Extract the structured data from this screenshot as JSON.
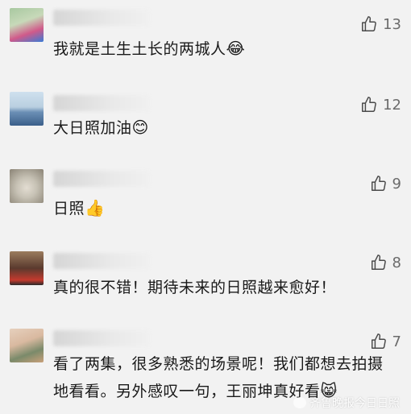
{
  "comments": [
    {
      "likes": "13",
      "text": "我就是土生土长的两城人",
      "emoji": "😂",
      "avatar_colors": [
        "#a8c8a0",
        "#d05a8a",
        "#3a7bd5"
      ]
    },
    {
      "likes": "12",
      "text": "大日照加油",
      "emoji": "😊",
      "avatar_colors": [
        "#b9cfe0",
        "#3b5f8a",
        "#e7eef5"
      ]
    },
    {
      "likes": "9",
      "text": "日照",
      "emoji": "👍",
      "avatar_colors": [
        "#c7c2b5",
        "#8a8375",
        "#e3ddd2"
      ]
    },
    {
      "likes": "8",
      "text": "真的很不错！期待未来的日照越来愈好！",
      "emoji": "",
      "avatar_colors": [
        "#5a3a2e",
        "#c43a2e",
        "#9b7c5e"
      ]
    },
    {
      "likes": "7",
      "text": "看了两集，很多熟悉的场景呢！我们都想去拍摄地看看。另外感叹一句，王丽坤真好看",
      "emoji": "😸",
      "avatar_colors": [
        "#d9b9a0",
        "#7a8a6a",
        "#c9a07a"
      ]
    }
  ],
  "watermark": "齐鲁晚报今日日照"
}
